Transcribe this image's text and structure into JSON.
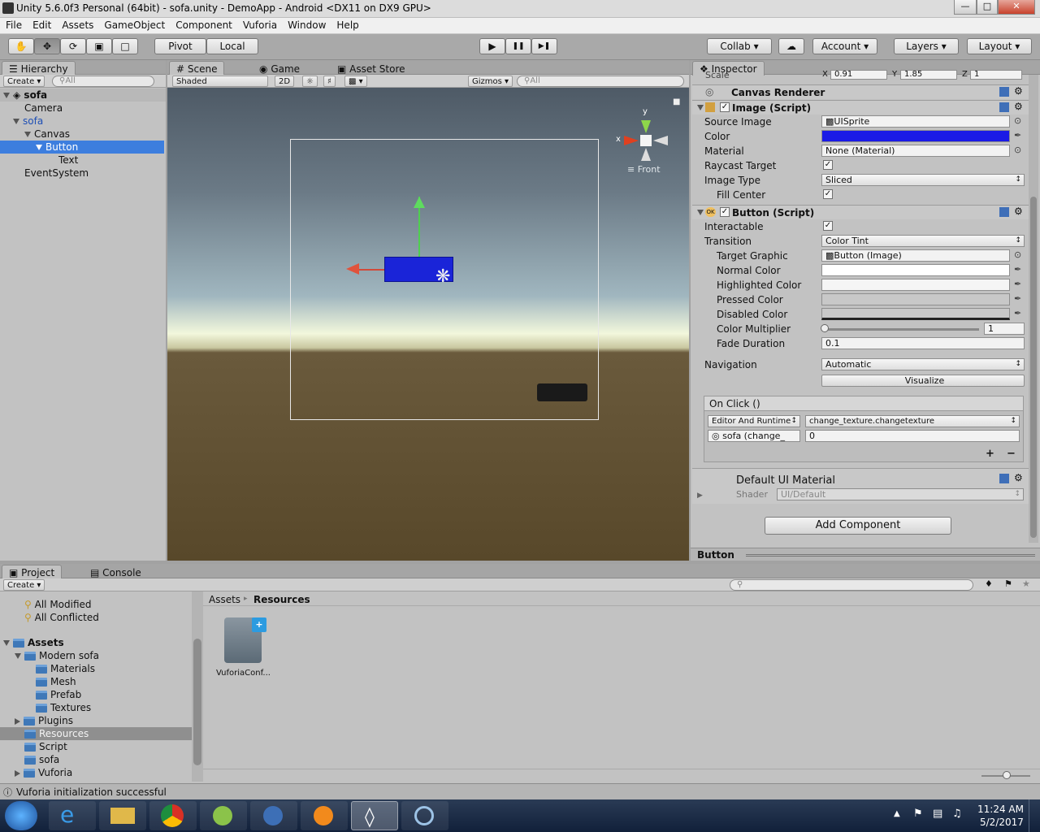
{
  "window": {
    "title": "Unity 5.6.0f3 Personal (64bit) - sofa.unity - DemoApp - Android <DX11 on DX9 GPU>",
    "min": "—",
    "max": "□",
    "close": "✕"
  },
  "menu": [
    "File",
    "Edit",
    "Assets",
    "GameObject",
    "Component",
    "Vuforia",
    "Window",
    "Help"
  ],
  "toolbar": {
    "pivot": "Pivot",
    "local": "Local",
    "collab": "Collab",
    "account": "Account",
    "layers": "Layers",
    "layout": "Layout",
    "play": "▶",
    "pause": "❚❚",
    "step": "▶❚",
    "arrow": "▾"
  },
  "hierarchy": {
    "tab": "Hierarchy",
    "create": "Create",
    "search": "All",
    "scene": "sofa",
    "items": [
      "Camera",
      "sofa",
      "Canvas",
      "Button",
      "Text",
      "EventSystem"
    ]
  },
  "scene": {
    "tab_scene": "Scene",
    "tab_game": "Game",
    "tab_store": "Asset Store",
    "shaded": "Shaded",
    "mode2d": "2D",
    "gizmos": "Gizmos",
    "search": "All",
    "front": "Front",
    "axis_x": "x",
    "axis_y": "y"
  },
  "inspector": {
    "tab": "Inspector",
    "scale_label": "Scale",
    "scale_x_l": "X",
    "scale_x": "0.91",
    "scale_y_l": "Y",
    "scale_y": "1.85",
    "scale_z_l": "Z",
    "scale_z": "1",
    "canvas_renderer": "Canvas Renderer",
    "image_script": "Image (Script)",
    "source_image_l": "Source Image",
    "source_image": "UISprite",
    "color_l": "Color",
    "color_value": "#1a1ae6",
    "material_l": "Material",
    "material": "None (Material)",
    "raycast_l": "Raycast Target",
    "image_type_l": "Image Type",
    "image_type": "Sliced",
    "fill_center_l": "Fill Center",
    "button_script": "Button (Script)",
    "interactable_l": "Interactable",
    "transition_l": "Transition",
    "transition": "Color Tint",
    "target_graphic_l": "Target Graphic",
    "target_graphic": "Button (Image)",
    "normal_l": "Normal Color",
    "highlighted_l": "Highlighted Color",
    "pressed_l": "Pressed Color",
    "disabled_l": "Disabled Color",
    "multiplier_l": "Color Multiplier",
    "multiplier": "1",
    "fade_l": "Fade Duration",
    "fade": "0.1",
    "navigation_l": "Navigation",
    "navigation": "Automatic",
    "visualize": "Visualize",
    "onclick": "On Click ()",
    "runtime": "Editor And Runtime",
    "method": "change_texture.changetexture",
    "object": "sofa (change_",
    "arg": "0",
    "plus": "+",
    "minus": "−",
    "default_mat": "Default UI Material",
    "shader_l": "Shader",
    "shader": "UI/Default",
    "add_component": "Add Component",
    "footer": "Button"
  },
  "project": {
    "tab_project": "Project",
    "tab_console": "Console",
    "create": "Create",
    "tree": [
      {
        "label": "All Modified",
        "indent": 0
      },
      {
        "label": "All Conflicted",
        "indent": 0
      }
    ],
    "assets_root": "Assets",
    "folders": [
      "Modern sofa",
      "Materials",
      "Mesh",
      "Prefab",
      "Textures",
      "Plugins",
      "Resources",
      "Script",
      "sofa",
      "Vuforia"
    ],
    "breadcrumb_1": "Assets",
    "breadcrumb_sep": "▸",
    "breadcrumb_2": "Resources",
    "file": "VuforiaConf..."
  },
  "status": "Vuforia initialization successful",
  "taskbar": {
    "time": "11:24 AM",
    "date": "5/2/2017"
  }
}
